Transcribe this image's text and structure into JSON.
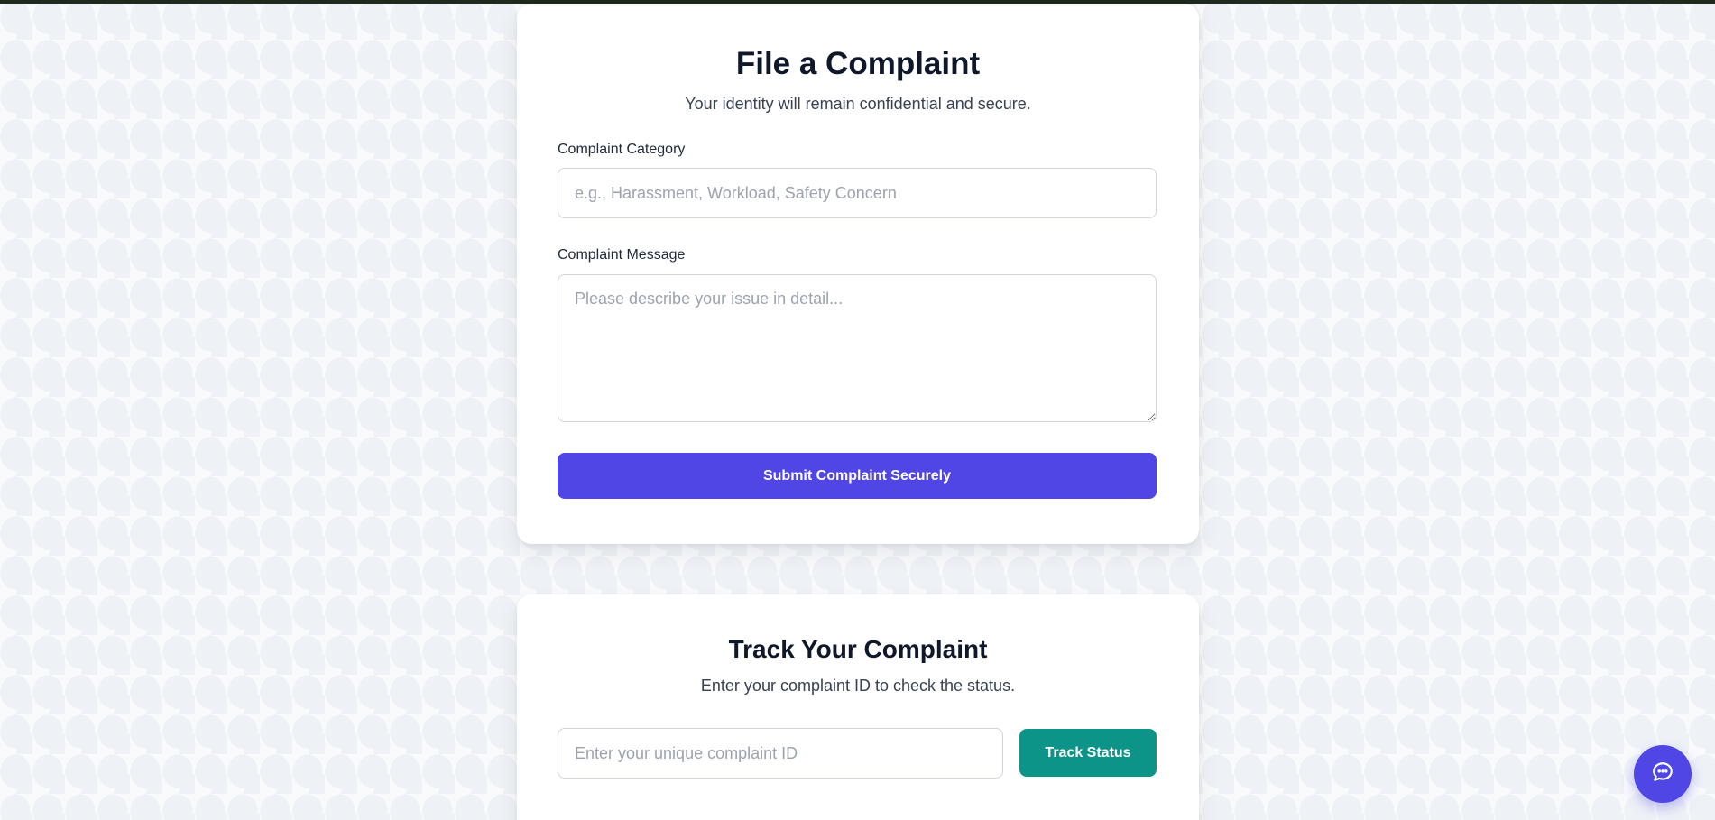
{
  "complaint_form": {
    "title": "File a Complaint",
    "subtitle": "Your identity will remain confidential and secure.",
    "category_label": "Complaint Category",
    "category_placeholder": "e.g., Harassment, Workload, Safety Concern",
    "category_value": "",
    "message_label": "Complaint Message",
    "message_placeholder": "Please describe your issue in detail...",
    "message_value": "",
    "submit_label": "Submit Complaint Securely"
  },
  "track_form": {
    "title": "Track Your Complaint",
    "subtitle": "Enter your complaint ID to check the status.",
    "id_placeholder": "Enter your unique complaint ID",
    "id_value": "",
    "track_label": "Track Status"
  },
  "chat_button": {
    "icon": "chat-bubble-icon"
  },
  "colors": {
    "primary": "#4f46e5",
    "teal": "#0d9488",
    "heading": "#0f172a",
    "page_background": "#f8fafc"
  }
}
